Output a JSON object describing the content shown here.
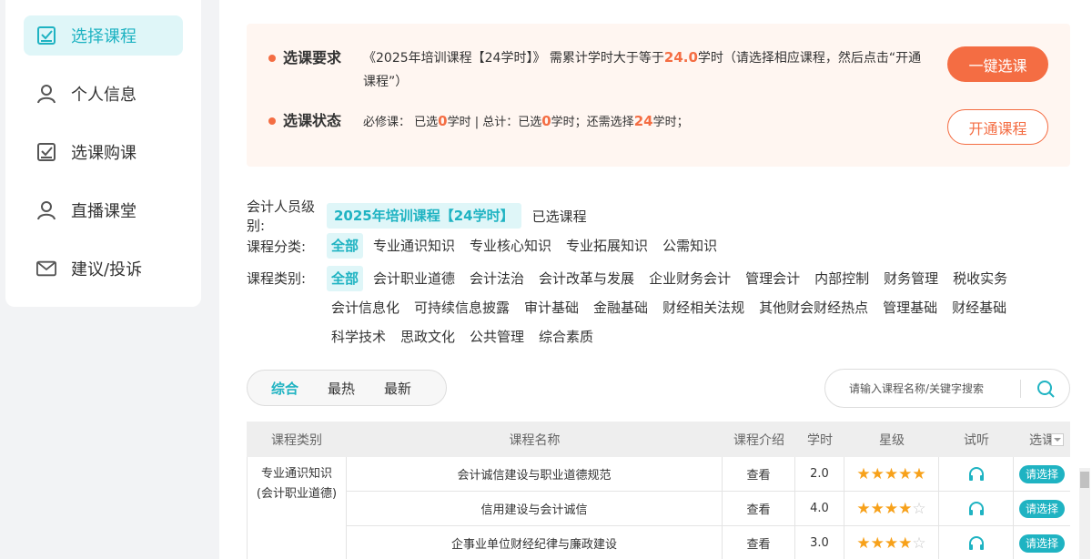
{
  "sidebar": {
    "items": [
      {
        "label": "选择课程",
        "icon": "checkbox-icon",
        "active": true
      },
      {
        "label": "个人信息",
        "icon": "user-icon",
        "active": false
      },
      {
        "label": "选课购课",
        "icon": "checkbox-icon",
        "active": false
      },
      {
        "label": "直播课堂",
        "icon": "user-icon",
        "active": false
      },
      {
        "label": "建议/投诉",
        "icon": "mail-icon",
        "active": false
      }
    ]
  },
  "requirement": {
    "label": "选课要求",
    "prefix": "《2025年培训课程【24学时】》 需累计学时大于等于",
    "hours": "24.0",
    "suffix": "学时（请选择相应课程，然后点击“开通课程”）"
  },
  "status": {
    "label": "选课状态",
    "t1": "必修课：  已选",
    "v1": "0",
    "t2": "学时 | 总计：已选",
    "v2": "0",
    "t3": "学时；还需选择",
    "v3": "24",
    "t4": "学时；"
  },
  "buttons": {
    "onekey": "一键选课",
    "open": "开通课程"
  },
  "filters": {
    "level_label": "会计人员级别:",
    "level_selected": "2025年培训课程【24学时】",
    "level_other": "已选课程",
    "category_label": "课程分类:",
    "categories": [
      "全部",
      "专业通识知识",
      "专业核心知识",
      "专业拓展知识",
      "公需知识"
    ],
    "type_label": "课程类别:",
    "types": [
      "全部",
      "会计职业道德",
      "会计法治",
      "会计改革与发展",
      "企业财务会计",
      "管理会计",
      "内部控制",
      "财务管理",
      "税收实务",
      "会计信息化",
      "可持续信息披露",
      "审计基础",
      "金融基础",
      "财经相关法规",
      "其他财会财经热点",
      "管理基础",
      "财经基础",
      "科学技术",
      "思政文化",
      "公共管理",
      "综合素质"
    ]
  },
  "sort": {
    "tabs": [
      "综合",
      "最热",
      "最新"
    ]
  },
  "search": {
    "placeholder": "请输入课程名称/关键字搜索"
  },
  "table": {
    "headers": [
      "课程类别",
      "课程名称",
      "课程介绍",
      "学时",
      "星级",
      "试听",
      "选课"
    ],
    "category_cell": [
      "专业通识知识",
      "(会计职业道德)"
    ],
    "rows": [
      {
        "name": "会计诚信建设与职业道德规范",
        "intro": "查看",
        "hours": "2.0",
        "stars": 5,
        "action": "请选择"
      },
      {
        "name": "信用建设与会计诚信",
        "intro": "查看",
        "hours": "4.0",
        "stars": 4,
        "action": "请选择"
      },
      {
        "name": "企事业单位财经纪律与廉政建设",
        "intro": "查看",
        "hours": "3.0",
        "stars": 4,
        "action": "请选择"
      }
    ]
  },
  "colors": {
    "accent": "#1fb3c2",
    "orange": "#f46d43",
    "star": "#f7a11a"
  }
}
